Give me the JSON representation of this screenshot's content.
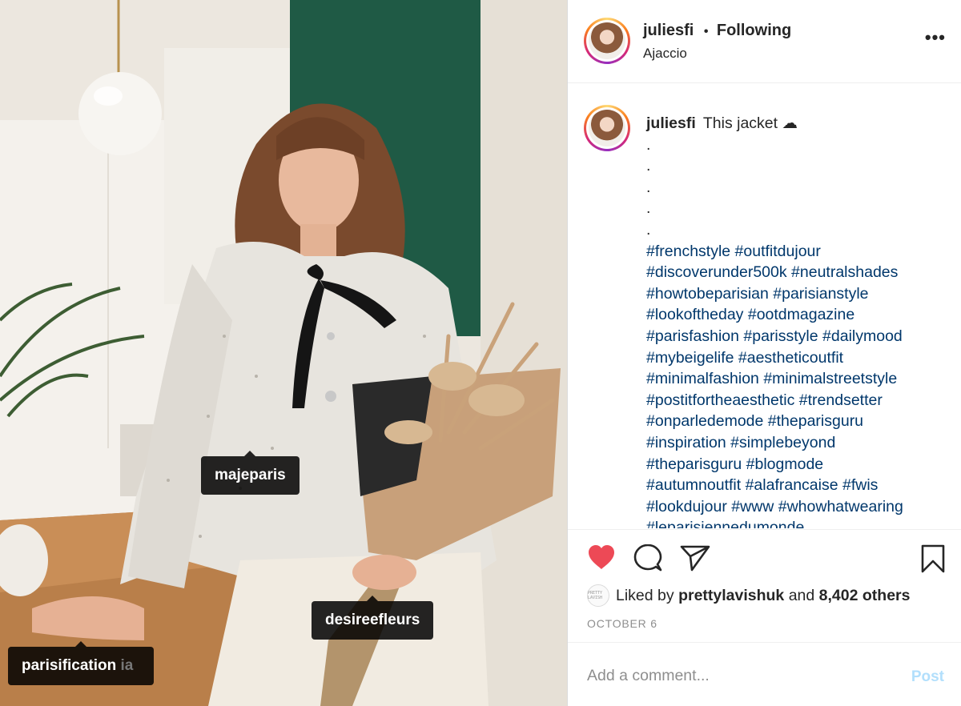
{
  "photo": {
    "tags": [
      {
        "label": "majeparis"
      },
      {
        "label": "desireefleurs"
      },
      {
        "label": "parisification",
        "ghost": "ia"
      }
    ]
  },
  "header": {
    "username": "juliesfi",
    "separator": "•",
    "follow_status": "Following",
    "location": "Ajaccio",
    "more_icon": "more-horizontal-icon",
    "more_glyph": "•••"
  },
  "caption": {
    "username": "juliesfi",
    "text": "This jacket ☁",
    "dots": [
      ".",
      ".",
      ".",
      ".",
      "."
    ],
    "hashtag_lines": [
      "#frenchstyle #outfitdujour",
      "#discoverunder500k #neutralshades",
      "#howtobeparisian #parisianstyle",
      "#lookoftheday #ootdmagazine",
      "#parisfashion #parisstyle #dailymood",
      "#mybeigelife #aestheticoutfit",
      "#minimalfashion #minimalstreetstyle",
      "#postitfortheaesthetic #trendsetter",
      "#onparledemode #theparisguru",
      "#inspiration #simplebeyond",
      "#theparisguru #blogmode",
      "#autumnoutfit #alafrancaise #fwis",
      "#lookdujour #www #whowhatwearing",
      "#leparisiennedumonde"
    ]
  },
  "actions": {
    "like_icon": "heart-filled-icon",
    "comment_icon": "comment-icon",
    "share_icon": "paper-plane-icon",
    "save_icon": "bookmark-icon",
    "like_color": "#ed4956"
  },
  "likes": {
    "prefix": "Liked by",
    "user": "prettylavishuk",
    "connector": "and",
    "others": "8,402 others",
    "avatar_text": "PRETTY LAVISH"
  },
  "date": "OCTOBER 6",
  "comment": {
    "placeholder": "Add a comment...",
    "post_label": "Post"
  },
  "colors": {
    "hashtag": "#00376b",
    "post_disabled": "#b2dffc",
    "muted": "#8e8e8e"
  }
}
